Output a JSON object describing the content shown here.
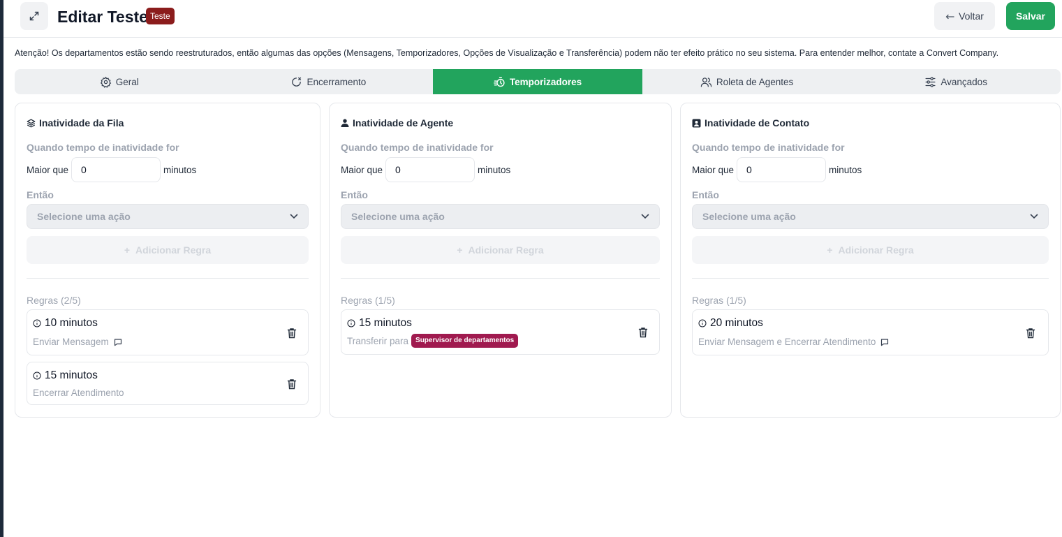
{
  "header": {
    "title": "Editar Teste",
    "badge": "Teste",
    "back_label": "Voltar",
    "save_label": "Salvar"
  },
  "notice": "Atenção! Os departamentos estão sendo reestruturados, então algumas das opções (Mensagens, Temporizadores, Opções de Visualização e Transferência) podem não ter efeito prático no seu sistema. Para entender melhor, contate a Convert Company.",
  "tabs": [
    {
      "label": "Geral",
      "icon": "gear-icon",
      "active": false
    },
    {
      "label": "Encerramento",
      "icon": "timer-off-icon",
      "active": false
    },
    {
      "label": "Temporizadores",
      "icon": "stopwatch-icon",
      "active": true
    },
    {
      "label": "Roleta de Agentes",
      "icon": "users-icon",
      "active": false
    },
    {
      "label": "Avançados",
      "icon": "sliders-icon",
      "active": false
    }
  ],
  "colors": {
    "primary": "#22a45d",
    "title_badge": "#8b1c1c",
    "dept_badge": "#a01a4f"
  },
  "cards": [
    {
      "title": "Inatividade da Fila",
      "icon": "layers-icon",
      "condition_label": "Quando tempo de inatividade for",
      "greater_label": "Maior que",
      "value": "0",
      "unit": "minutos",
      "then_label": "Então",
      "select_placeholder": "Selecione uma ação",
      "add_rule_label": "Adicionar Regra",
      "rules_label": "Regras (2/5)",
      "rules": [
        {
          "time": "10 minutos",
          "desc": "Enviar Mensagem"
        },
        {
          "time": "15 minutos",
          "desc": "Encerrar Atendimento"
        }
      ]
    },
    {
      "title": "Inatividade de Agente",
      "icon": "user-icon",
      "condition_label": "Quando tempo de inatividade for",
      "greater_label": "Maior que",
      "value": "0",
      "unit": "minutos",
      "then_label": "Então",
      "select_placeholder": "Selecione uma ação",
      "add_rule_label": "Adicionar Regra",
      "rules_label": "Regras (1/5)",
      "rules": [
        {
          "time": "15 minutos",
          "desc": "Transferir para",
          "badge": "Supervisor de departamentos"
        }
      ]
    },
    {
      "title": "Inatividade de Contato",
      "icon": "contact-card-icon",
      "condition_label": "Quando tempo de inatividade for",
      "greater_label": "Maior que",
      "value": "0",
      "unit": "minutos",
      "then_label": "Então",
      "select_placeholder": "Selecione uma ação",
      "add_rule_label": "Adicionar Regra",
      "rules_label": "Regras (1/5)",
      "rules": [
        {
          "time": "20 minutos",
          "desc": "Enviar Mensagem e Encerrar Atendimento"
        }
      ]
    }
  ]
}
